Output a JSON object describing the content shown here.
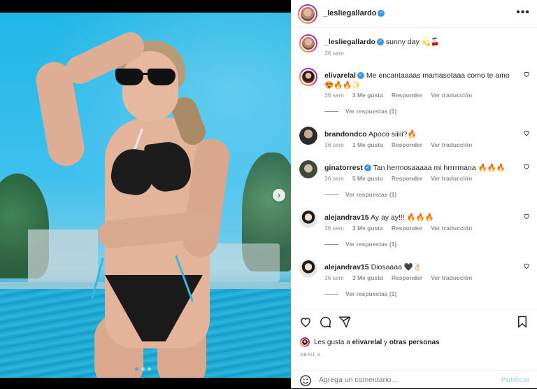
{
  "post": {
    "username": "_lesliegallardo",
    "caption": "sunny day 💫🍒",
    "time": "36 sem",
    "carousel": {
      "total_slides": 3,
      "active_slide": 1
    }
  },
  "comments": [
    {
      "username": "elivarelal",
      "text": "Me encantaaaas mamasotaaa como te amo 😍🔥🔥✨",
      "time": "36 sem",
      "likes": "3 Me gusta",
      "reply": "Responder",
      "translate": "Ver traducción",
      "replies": "Ver respuestas (1)"
    },
    {
      "username": "brandondco",
      "text": "Apoco siiiii?🔥",
      "time": "36 sem",
      "likes": "1 Me gusta",
      "reply": "Responder",
      "translate": "Ver traducción",
      "replies": ""
    },
    {
      "username": "ginatorrest",
      "text": "Tan hermosaaaaa mi hrrrrmana 🔥🔥🔥",
      "time": "36 sem",
      "likes": "5 Me gusta",
      "reply": "Responder",
      "translate": "Ver traducción",
      "replies": "Ver respuestas (1)"
    },
    {
      "username": "alejandrav15",
      "text": "Ay ay ay!!! 🔥🔥🔥",
      "time": "36 sem",
      "likes": "3 Me gusta",
      "reply": "Responder",
      "translate": "Ver traducción",
      "replies": "Ver respuestas (1)"
    },
    {
      "username": "alejandrav15",
      "text": "Diosaaaa 🖤👌🏻",
      "time": "36 sem",
      "likes": "3 Me gusta",
      "reply": "Responder",
      "translate": "Ver traducción",
      "replies": "Ver respuestas (1)"
    }
  ],
  "likes_line": {
    "prefix": "Les gusta a",
    "user": "elivarelal",
    "joiner": "y",
    "others": "otras personas"
  },
  "date": "ABRIL 8",
  "composer": {
    "placeholder": "Agrega un comentario...",
    "post_label": "Publicar"
  },
  "icons": {
    "more": "more-options-icon",
    "like": "heart-icon",
    "comment": "comment-icon",
    "share": "share-icon",
    "save": "bookmark-icon",
    "emoji": "emoji-icon",
    "next": "chevron-right-icon"
  },
  "colors": {
    "verified": "#3897f0",
    "link_muted": "#8e8e8e",
    "publish": "#b3dbff",
    "active_dot": "#4aa3f0"
  }
}
